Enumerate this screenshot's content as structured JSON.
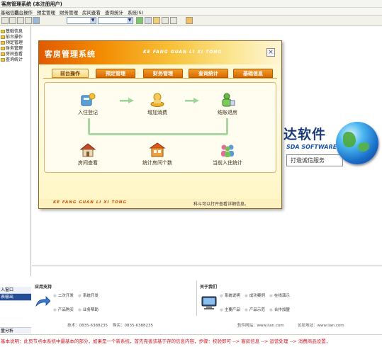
{
  "window": {
    "title": "客房管理系统 (本注册用户)"
  },
  "menu": [
    "基础信息",
    "前台操作",
    "预定管理",
    "财务管理",
    "房间查看",
    "查询统计",
    "系统(S)"
  ],
  "tree": [
    "基础信息",
    "前台操作",
    "预定管理",
    "财务管理",
    "房间查看",
    "查询统计"
  ],
  "brand": {
    "name": "达软件",
    "software": "SDA SOFTWARE",
    "slogan": "打造诚信服务"
  },
  "dialog": {
    "title": "客房管理系统",
    "pinyin": "KE FANG GUAN LI XI TONG",
    "close": "×",
    "tabs": [
      "前台操作",
      "预定管理",
      "财务管理",
      "查询统计",
      "基础信息"
    ],
    "functions": [
      {
        "label": "入住登记",
        "icon": "checkin-icon"
      },
      {
        "label": "增加消费",
        "icon": "consume-icon"
      },
      {
        "label": "结账退房",
        "icon": "checkout-icon"
      },
      {
        "label": "房间查看",
        "icon": "house-icon"
      },
      {
        "label": "统计房间个数",
        "icon": "room-count-icon"
      },
      {
        "label": "当前入住统计",
        "icon": "guests-icon"
      }
    ],
    "footer_pinyin": "KE FANG GUAN LI XI TONG",
    "footer_tip": "科斗可以打开查看详细信息。"
  },
  "info": {
    "support_title": "应用支持",
    "support_items": [
      "二次开发",
      "系统开发",
      "产品购买",
      "业务帮助"
    ],
    "about_title": "关于我们",
    "about_items": [
      "系统说明",
      "成功案例",
      "在线演示",
      "主要产品",
      "产品示范",
      "合作加盟"
    ],
    "contact_tech": "技术：0835-6388235",
    "contact_sales": "购买：0835-6388235",
    "contact_web": "软件网站：www.lian.com",
    "contact_forum": "论坛地址：www.lian.com"
  },
  "left_buttons": [
    "入窗口",
    "表输出"
  ],
  "bottom_tab": "量分析",
  "marquee": "基本说明：此页节点本系统中最基本的部分，如果是一个新系统，首先完善该基于存的信息内容，步骤：校验即可 --> 客房信息 --> 运营处理 --> 消费商品设置，"
}
